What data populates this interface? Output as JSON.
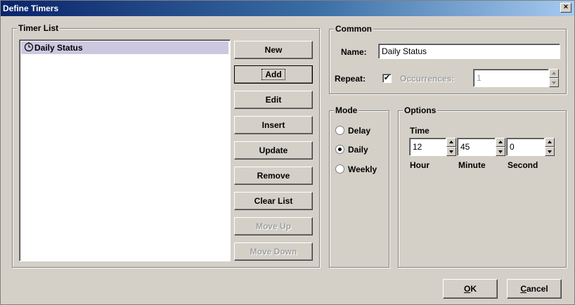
{
  "window": {
    "title": "Define Timers",
    "close_label": "×"
  },
  "timer_list": {
    "title": "Timer List",
    "items": [
      {
        "label": "Daily Status",
        "icon": "clock-icon",
        "selected": true
      }
    ]
  },
  "buttons": {
    "new": "New",
    "add": "Add",
    "edit": "Edit",
    "insert": "Insert",
    "update": "Update",
    "remove": "Remove",
    "clear_list": "Clear List",
    "move_up": "Move Up",
    "move_down": "Move Down"
  },
  "common": {
    "title": "Common",
    "name_label": "Name:",
    "name_value": "Daily Status",
    "repeat_label": "Repeat:",
    "repeat_checked": true,
    "occurrences_label": "Occurrences:",
    "occurrences_value": "1"
  },
  "mode": {
    "title": "Mode",
    "options": [
      {
        "label": "Delay",
        "checked": false
      },
      {
        "label": "Daily",
        "checked": true
      },
      {
        "label": "Weekly",
        "checked": false
      }
    ]
  },
  "options": {
    "title": "Options",
    "time_label": "Time",
    "hour_value": "12",
    "minute_value": "45",
    "second_value": "0",
    "hour_label": "Hour",
    "minute_label": "Minute",
    "second_label": "Second"
  },
  "dialog_buttons": {
    "ok_mnemonic": "O",
    "ok_rest": "K",
    "cancel_mnemonic": "C",
    "cancel_rest": "ancel"
  }
}
